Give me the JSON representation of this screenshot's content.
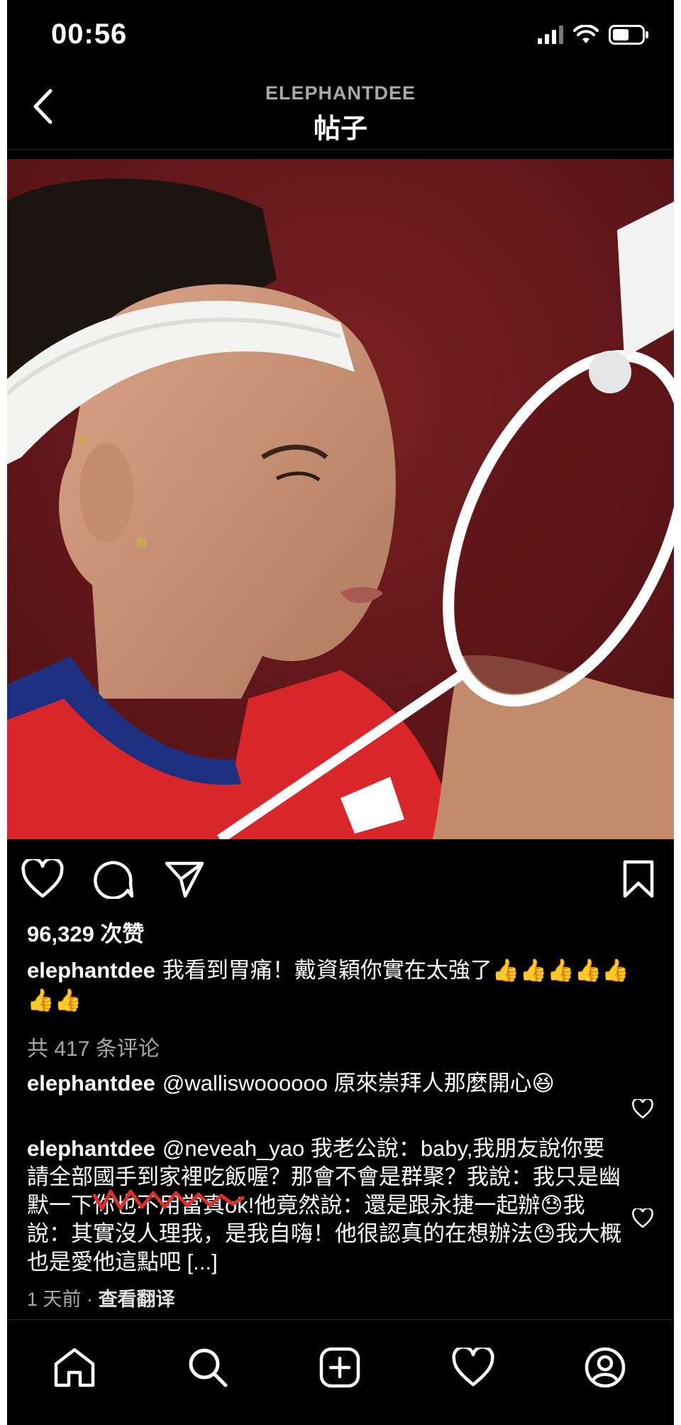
{
  "status_bar": {
    "time": "00:56",
    "icons": [
      "signal-icon",
      "wifi-icon",
      "battery-icon"
    ]
  },
  "header": {
    "username": "ELEPHANTDEE",
    "title": "帖子",
    "back_icon": "chevron-left-icon"
  },
  "post": {
    "likes": "96,329 次赞",
    "caption": {
      "username": "elephantdee",
      "text": "我看到胃痛！戴資穎你實在太強了👍👍👍👍👍👍👍"
    },
    "view_all_comments": "共 417 条评论",
    "comments": [
      {
        "username": "elephantdee",
        "text": "@walliswoooooo 原來崇拜人那麼開心😆"
      },
      {
        "username": "elephantdee",
        "text": "@neveah_yao 我老公說：baby,我朋友說你要請全部國手到家裡吃飯喔？那會不會是群聚？我說：我只是幽默一下你也不用當真ok!他竟然說：還是跟永捷一起辦😓我說：其實沒人理我，是我自嗨！他很認真的在想辦法😓我大概也是愛他這點吧 [...]"
      }
    ],
    "meta": {
      "time_ago": "1 天前",
      "separator": "·",
      "translate": "查看翻译"
    }
  },
  "action_icons": [
    "heart-icon",
    "comment-icon",
    "share-icon",
    "bookmark-icon"
  ],
  "tab_bar": [
    "home-icon",
    "search-icon",
    "add-post-icon",
    "activity-icon",
    "profile-icon"
  ],
  "colors": {
    "background": "#000000",
    "text": "#ffffff",
    "secondary": "#a8a8a8",
    "scribble": "#d9302c"
  }
}
